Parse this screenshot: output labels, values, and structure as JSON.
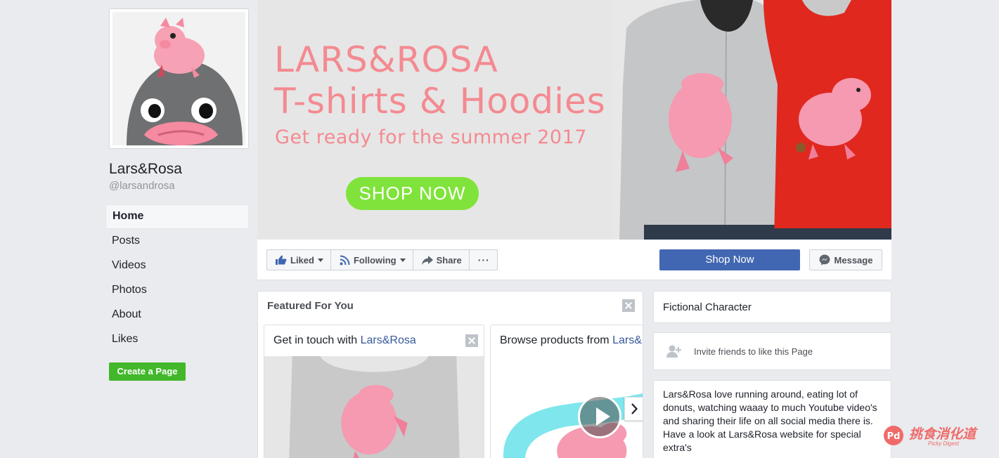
{
  "profile": {
    "name": "Lars&Rosa",
    "handle": "@larsandrosa"
  },
  "nav": {
    "items": [
      {
        "label": "Home",
        "active": true
      },
      {
        "label": "Posts"
      },
      {
        "label": "Videos"
      },
      {
        "label": "Photos"
      },
      {
        "label": "About"
      },
      {
        "label": "Likes"
      }
    ],
    "create_page": "Create a Page"
  },
  "cover": {
    "title_line1": "LARS&ROSA",
    "title_line2": "T-shirts & Hoodies",
    "subtitle": "Get ready for the summer 2017",
    "cta": "SHOP NOW"
  },
  "actions": {
    "liked": "Liked",
    "following": "Following",
    "share": "Share",
    "more": "···",
    "shop_now": "Shop Now",
    "message": "Message"
  },
  "featured": {
    "title": "Featured For You",
    "card1_text": "Get in touch with ",
    "card1_link": "Lars&Rosa",
    "card2_text": "Browse products from ",
    "card2_link": "Lars&Rosa"
  },
  "sidebar": {
    "category": "Fictional Character",
    "invite": "Invite friends to like this Page",
    "about": "Lars&Rosa love running around, eating lot of donuts, watching waaay to much Youtube video's and sharing their life on all social media there is. Have a look at Lars&Rosa website for special extra's"
  },
  "watermark": {
    "logo": "Pd",
    "text": "挑食消化道",
    "sub": "Picky Digest"
  },
  "colors": {
    "fb_blue": "#4267b2",
    "link_blue": "#365899",
    "cover_pink": "#f48a91",
    "cta_green": "#80e33b",
    "create_green": "#42b72a"
  }
}
